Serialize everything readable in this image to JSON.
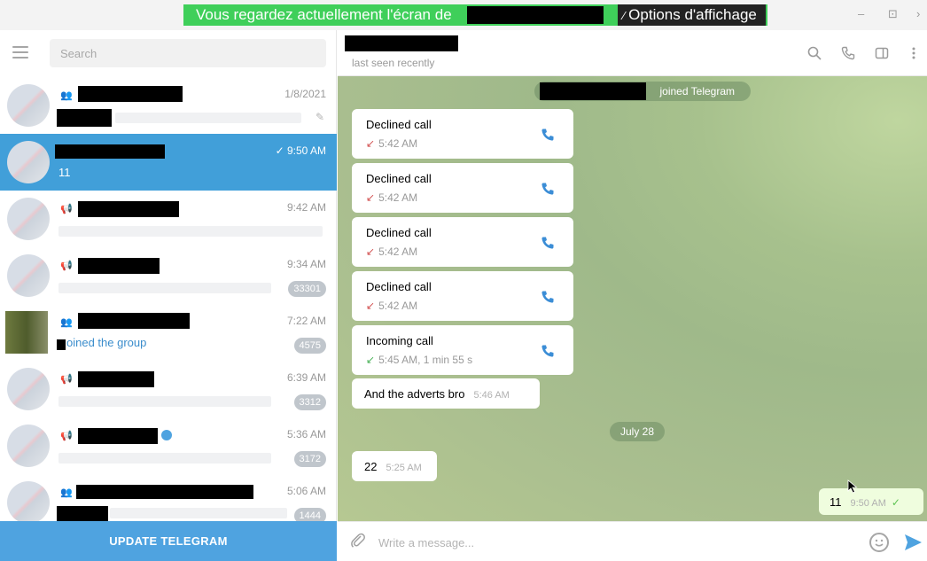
{
  "share_banner": {
    "text": "Vous regardez actuellement l'écran de",
    "options": "Options d'affichage"
  },
  "window_controls": {
    "minimize": "–",
    "maximize": "⊡",
    "close": "›"
  },
  "sidebar": {
    "search_placeholder": "Search",
    "chats": [
      {
        "type_icon": "group-icon",
        "time": "1/8/2021",
        "pinned": true
      },
      {
        "type_icon": "",
        "time": "✓ 9:50 AM",
        "preview": "11",
        "active": true
      },
      {
        "type_icon": "channel-icon",
        "time": "9:42 AM"
      },
      {
        "type_icon": "channel-icon",
        "time": "9:34 AM",
        "badge": "33301"
      },
      {
        "type_icon": "group-icon",
        "time": "7:22 AM",
        "preview": "oined the group",
        "badge": "4575"
      },
      {
        "type_icon": "channel-icon",
        "time": "6:39 AM",
        "badge": "3312"
      },
      {
        "type_icon": "channel-icon",
        "time": "5:36 AM",
        "badge": "3172",
        "verified": true
      },
      {
        "type_icon": "group-icon",
        "time": "5:06 AM",
        "badge": "1444"
      }
    ],
    "update_button": "UPDATE TELEGRAM"
  },
  "header": {
    "status": "last seen recently"
  },
  "messages": {
    "service": "joined Telegram",
    "calls": [
      {
        "title": "Declined call",
        "detail": "5:42 AM",
        "kind": "declined"
      },
      {
        "title": "Declined call",
        "detail": "5:42 AM",
        "kind": "declined"
      },
      {
        "title": "Declined call",
        "detail": "5:42 AM",
        "kind": "declined"
      },
      {
        "title": "Declined call",
        "detail": "5:42 AM",
        "kind": "declined"
      },
      {
        "title": "Incoming call",
        "detail": "5:45 AM, 1 min 55 s",
        "kind": "incoming"
      }
    ],
    "text_in_1": {
      "text": "And the adverts bro",
      "time": "5:46 AM"
    },
    "date_divider": "July 28",
    "text_in_2": {
      "text": "22",
      "time": "5:25 AM"
    },
    "text_out": {
      "text": "11",
      "time": "9:50 AM",
      "check": "✓"
    }
  },
  "composer": {
    "placeholder": "Write a message..."
  },
  "colors": {
    "accent": "#419fd9",
    "share_green": "#3fcf5a",
    "out_bubble": "#effdde"
  }
}
